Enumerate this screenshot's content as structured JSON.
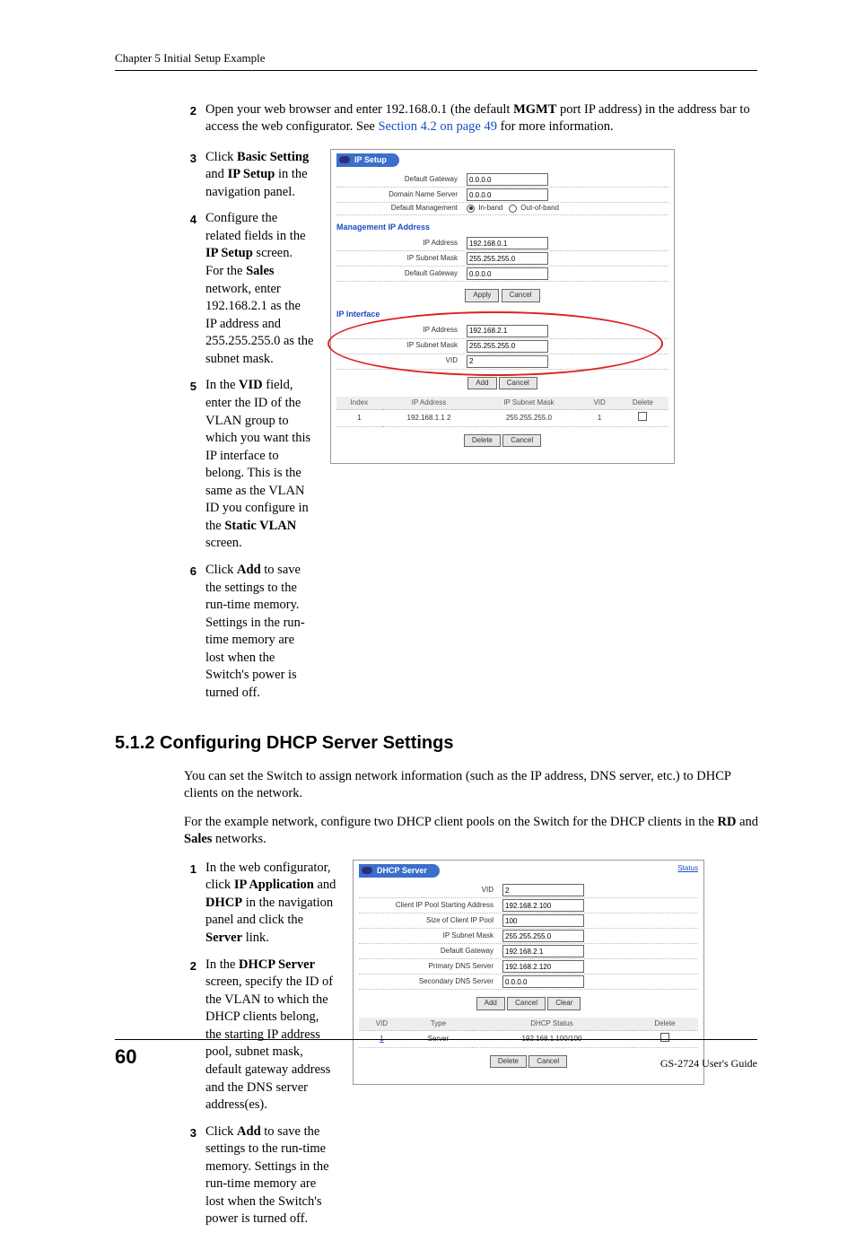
{
  "chapter_header": "Chapter 5 Initial Setup Example",
  "steps1": {
    "s2a": "Open your web browser and enter 192.168.0.1 (the default ",
    "s2b": "MGMT",
    "s2c": " port IP address) in the address bar to access the web configurator. See ",
    "s2link": "Section 4.2 on page 49",
    "s2d": " for more information.",
    "s3a": "Click ",
    "s3b": "Basic Setting",
    "s3c": " and ",
    "s3d": "IP Setup",
    "s3e": " in the navigation panel.",
    "s4a": "Configure the related fields in the ",
    "s4b": "IP Setup",
    "s4c": " screen.",
    "s4d": "For the ",
    "s4e": "Sales",
    "s4f": " network, enter 192.168.2.1 as the IP address and 255.255.255.0 as the subnet mask.",
    "s5a": "In the ",
    "s5b": "VID",
    "s5c": " field, enter the ID of the VLAN group to which you want this IP interface to belong. This is the same as the VLAN ID you configure in the ",
    "s5d": "Static VLAN",
    "s5e": " screen.",
    "s6a": "Click ",
    "s6b": "Add",
    "s6c": " to save the settings to the run-time memory. Settings in the run-time memory are lost when the Switch's power is turned off."
  },
  "ip_panel": {
    "tab": "IP Setup",
    "labels": {
      "def_gw": "Default Gateway",
      "dns": "Domain Name Server",
      "def_mgmt": "Default Management",
      "inband": "In-band",
      "outofband": "Out-of-band",
      "mgmt_ip": "Management IP Address",
      "ip": "IP Address",
      "mask": "IP Subnet Mask",
      "vid": "VID",
      "apply": "Apply",
      "cancel": "Cancel",
      "add": "Add",
      "delete": "Delete",
      "ip_iface": "IP Interface"
    },
    "vals": {
      "zero": "0.0.0.0",
      "mgmt_ip": "192.168.0.1",
      "mgmt_mask": "255.255.255.0",
      "iface_ip": "192.168.2.1",
      "iface_mask": "255.255.255.0",
      "iface_vid": "2"
    },
    "table": {
      "h1": "Index",
      "h2": "IP Address",
      "h3": "IP Subnet Mask",
      "h4": "VID",
      "h5": "Delete",
      "r1_idx": "1",
      "r1_ip": "192.168.1.1 2",
      "r1_mask": "255.255.255.0",
      "r1_vid": "1"
    }
  },
  "heading2": "5.1.2  Configuring DHCP Server Settings",
  "para1": "You can set the Switch to assign network information (such as the IP address, DNS server, etc.) to DHCP clients on the network.",
  "para2a": "For the example network, configure two DHCP client pools on the Switch for the DHCP clients in the ",
  "para2b": "RD",
  "para2c": " and ",
  "para2d": "Sales",
  "para2e": " networks.",
  "steps2": {
    "s1a": "In the web configurator, click ",
    "s1b": "IP Application",
    "s1c": " and ",
    "s1d": "DHCP",
    "s1e": " in the navigation panel and click the ",
    "s1f": "Server",
    "s1g": " link.",
    "s2a": "In the ",
    "s2b": "DHCP Server",
    "s2c": " screen, specify the ID of the VLAN to which the DHCP clients belong, the starting IP address pool, subnet mask, default gateway address and the DNS server address(es).",
    "s3a": "Click ",
    "s3b": "Add",
    "s3c": " to save the settings to the run-time memory. Settings in the run-time memory are lost when the Switch's power is turned off."
  },
  "dhcp_panel": {
    "tab": "DHCP Server",
    "status": "Status",
    "labels": {
      "vid": "VID",
      "start": "Client IP Pool Starting Address",
      "size": "Size of Client IP Pool",
      "mask": "IP Subnet Mask",
      "gw": "Default Gateway",
      "pdns": "Primary DNS Server",
      "sdns": "Secondary DNS Server",
      "add": "Add",
      "cancel": "Cancel",
      "clear": "Clear",
      "delete": "Delete"
    },
    "vals": {
      "vid": "2",
      "start": "192.168.2.100",
      "size": "100",
      "mask": "255.255.255.0",
      "gw": "192.168.2.1",
      "pdns": "192.168.2.120",
      "sdns": "0.0.0.0"
    },
    "table": {
      "h1": "VID",
      "h2": "Type",
      "h3": "DHCP Status",
      "h4": "Delete",
      "r1_vid": "1",
      "r1_type": "Server",
      "r1_stat": "192.168.1.100/100"
    }
  },
  "footer": {
    "page": "60",
    "guide": "GS-2724 User's Guide"
  }
}
